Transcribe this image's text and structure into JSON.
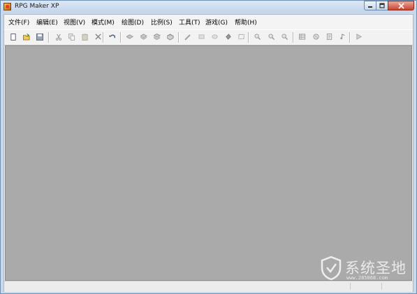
{
  "window": {
    "title": "RPG Maker XP",
    "minimize_icon": "minimize-icon",
    "maximize_icon": "maximize-icon",
    "close_icon": "close-icon"
  },
  "menu": [
    {
      "label": "文件(F)"
    },
    {
      "label": "编辑(E)"
    },
    {
      "label": "视图(V)"
    },
    {
      "label": "模式(M)"
    },
    {
      "label": "绘图(D)"
    },
    {
      "label": "比例(S)"
    },
    {
      "label": "工具(T)"
    },
    {
      "label": "游戏(G)"
    },
    {
      "label": "帮助(H)"
    }
  ],
  "toolbar": [
    "new-file-icon",
    "open-folder-icon",
    "save-icon",
    "cut-icon",
    "copy-icon",
    "paste-icon",
    "delete-icon",
    "undo-icon",
    "layer1-icon",
    "layer2-icon",
    "layer3-icon",
    "events-layer-icon",
    "pencil-icon",
    "rectangle-icon",
    "ellipse-icon",
    "fill-icon",
    "select-icon",
    "zoom-1-1-icon",
    "zoom-1-2-icon",
    "zoom-1-4-icon",
    "database-icon",
    "materialbase-icon",
    "script-editor-icon",
    "sound-test-icon",
    "playtest-icon"
  ],
  "watermark": {
    "text": "系统圣地",
    "url": "www.285868.com"
  },
  "colors": {
    "workspace": "#aaaaaa",
    "frame": "#c9d9ea"
  }
}
